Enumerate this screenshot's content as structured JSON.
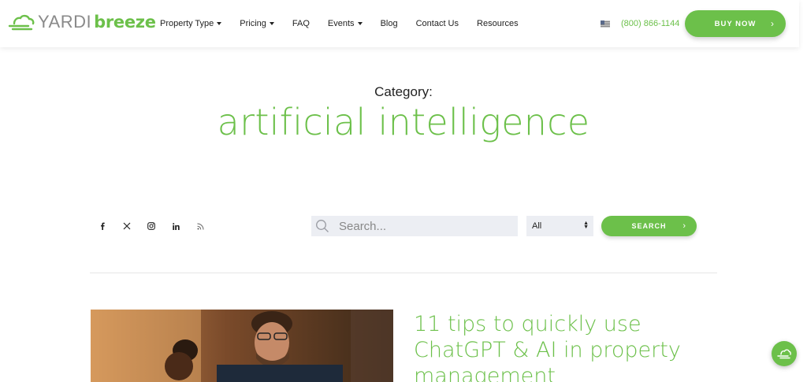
{
  "logo": {
    "yardi": "YARDI",
    "breeze": "breeze"
  },
  "nav": {
    "items": [
      {
        "label": "Property Type",
        "dropdown": true
      },
      {
        "label": "Pricing",
        "dropdown": true
      },
      {
        "label": "FAQ",
        "dropdown": false
      },
      {
        "label": "Events",
        "dropdown": true
      },
      {
        "label": "Blog",
        "dropdown": false
      },
      {
        "label": "Contact Us",
        "dropdown": false
      },
      {
        "label": "Resources",
        "dropdown": false
      }
    ]
  },
  "header": {
    "phone": "(800) 866-1144",
    "buy_label": "BUY NOW",
    "flag_icon": "us-flag-icon"
  },
  "hero": {
    "category_label": "Category:",
    "category_title": "artificial intelligence"
  },
  "social": {
    "icons": [
      "facebook-icon",
      "x-twitter-icon",
      "instagram-icon",
      "linkedin-icon",
      "rss-icon"
    ]
  },
  "search": {
    "placeholder": "Search...",
    "filter_value": "All",
    "button_label": "SEARCH"
  },
  "article": {
    "title": "11 tips to quickly use ChatGPT & AI in property management"
  },
  "colors": {
    "accent": "#6cc04a",
    "field_bg": "#eceef3"
  }
}
